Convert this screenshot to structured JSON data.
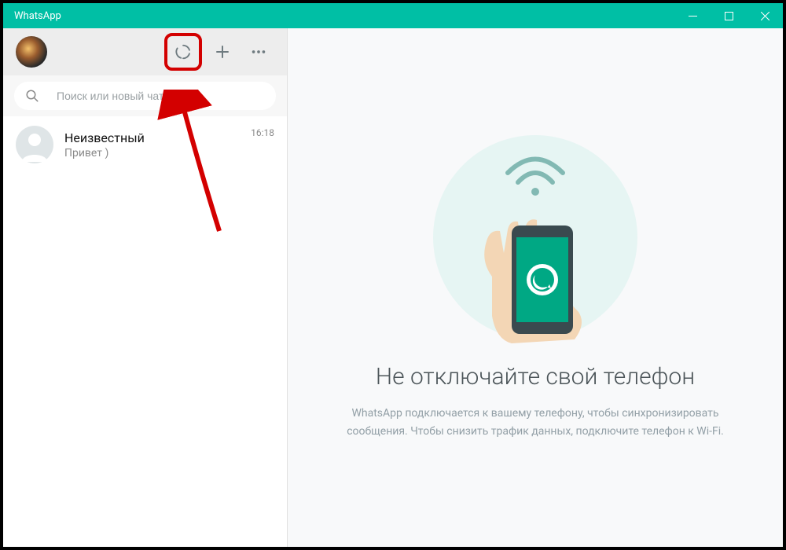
{
  "window": {
    "title": "WhatsApp"
  },
  "sidebar": {
    "search_placeholder": "Поиск или новый чат",
    "chats": [
      {
        "name": "Неизвестный",
        "preview": "Привет )",
        "time": "16:18"
      }
    ]
  },
  "main": {
    "headline": "Не отключайте свой телефон",
    "subtext_line1": "WhatsApp подключается к вашему телефону, чтобы синхронизировать",
    "subtext_line2": "сообщения. Чтобы снизить трафик данных, подключите телефон к Wi-Fi."
  },
  "colors": {
    "accent": "#00bfa5",
    "highlight": "#d30000"
  }
}
